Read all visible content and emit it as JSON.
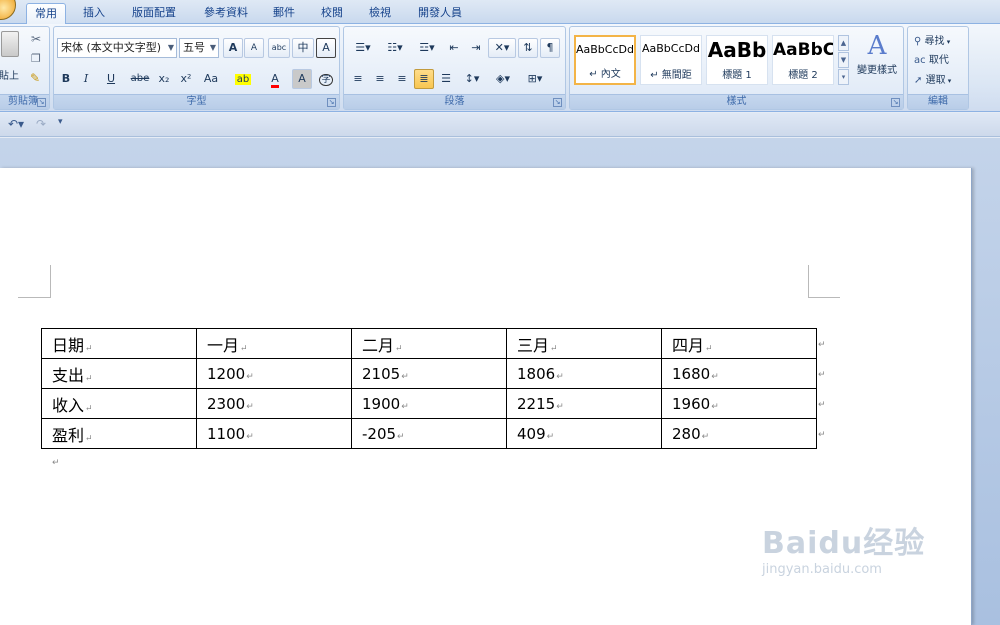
{
  "tabs": [
    "常用",
    "插入",
    "版面配置",
    "參考資料",
    "郵件",
    "校閱",
    "檢視",
    "開發人員"
  ],
  "clipboard": {
    "label": "剪貼簿",
    "paste_label": "貼上"
  },
  "font": {
    "label": "字型",
    "font_name": "宋体 (本文中文字型)",
    "font_size": "五号",
    "grow_label": "A",
    "shrink_label": "A",
    "phonetic_label": "abc",
    "convert_label": "中",
    "border_label": "A",
    "bold": "B",
    "italic": "I",
    "underline": "U",
    "strike": "abe",
    "subscript": "x₂",
    "superscript": "x²",
    "change_case": "Aa",
    "highlight": "ab",
    "font_color": "A",
    "shading": "A",
    "enclose": "字"
  },
  "paragraph": {
    "label": "段落"
  },
  "styles": {
    "label": "樣式",
    "items": [
      {
        "sample": "AaBbCcDd",
        "name": "↵ 內文"
      },
      {
        "sample": "AaBbCcDd",
        "name": "↵ 無間距"
      },
      {
        "sample": "AaBb",
        "name": "標題 1"
      },
      {
        "sample": "AaBbC",
        "name": "標題 2"
      }
    ],
    "change_styles": "變更樣式"
  },
  "editing": {
    "label": "編輯",
    "find": "尋找",
    "replace": "取代",
    "select": "選取"
  },
  "table": {
    "rows": [
      [
        "日期",
        "一月",
        "二月",
        "三月",
        "四月"
      ],
      [
        "支出",
        "1200",
        "2105",
        "1806",
        "1680"
      ],
      [
        "收入",
        "2300",
        "1900",
        "2215",
        "1960"
      ],
      [
        "盈利",
        "1100",
        "-205",
        "409",
        "280"
      ]
    ]
  },
  "paragraph_mark": "↵",
  "watermark": {
    "main": "Baidu经验",
    "sub": "jingyan.baidu.com"
  },
  "colors": {
    "accent": "#15428b",
    "highlight": "#ffff00",
    "font_color": "#ff0000"
  }
}
